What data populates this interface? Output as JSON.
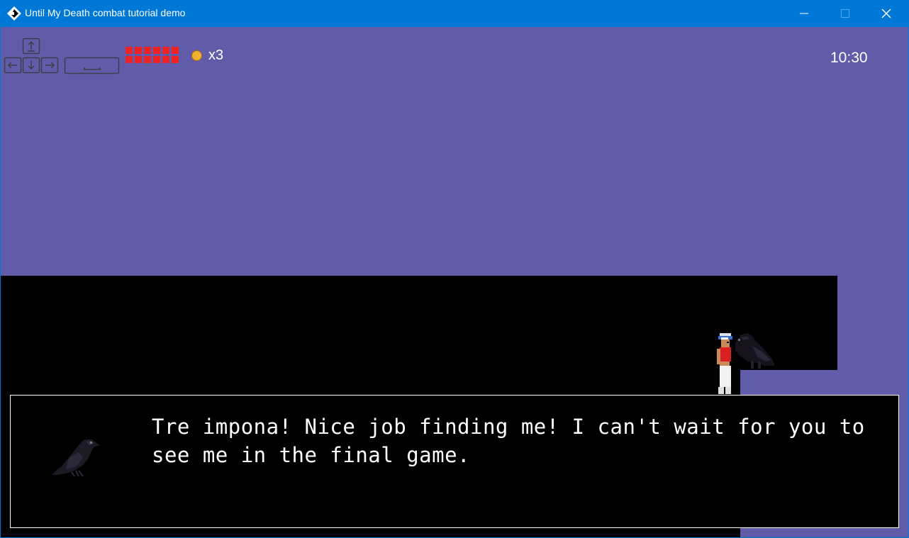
{
  "window": {
    "title": "Until My Death combat tutorial demo",
    "titlebar_color": "#0078d7",
    "icons": [
      "app-icon",
      "minimize-icon",
      "maximize-icon",
      "close-icon"
    ]
  },
  "hud": {
    "controls_icons": [
      "up-arrow-key-icon",
      "left-arrow-key-icon",
      "down-arrow-key-icon",
      "right-arrow-key-icon",
      "spacebar-key-icon"
    ],
    "health_blocks": 12,
    "health_color": "#ee2222",
    "coin_count": "x3",
    "timer": "10:30"
  },
  "scene": {
    "sky_color": "#615caa",
    "ground_color": "#000000"
  },
  "dialog": {
    "text": "Tre impona! Nice job finding me! I can't wait for you to see me in the final game.",
    "portrait": "crow-portrait"
  }
}
